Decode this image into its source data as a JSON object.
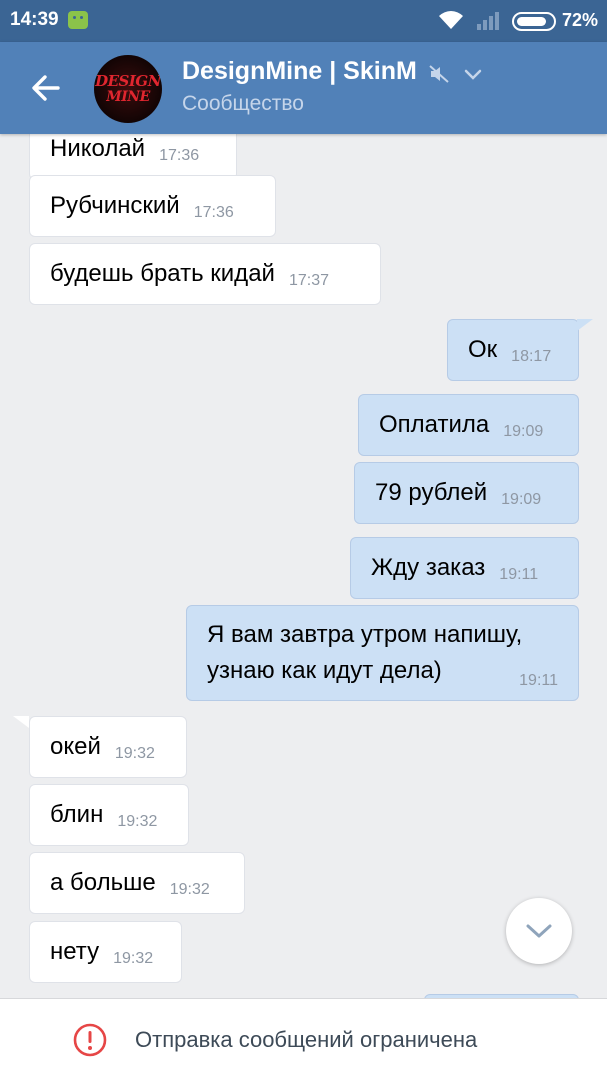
{
  "status_bar": {
    "time": "14:39",
    "battery": "72%",
    "icons": [
      "android-icon",
      "wifi-icon",
      "signal-icon",
      "battery-icon"
    ]
  },
  "header": {
    "title": "DesignMine | SkinM",
    "subtitle": "Сообщество",
    "avatar_text_line1": "DESIGN",
    "avatar_text_line2": "MINE",
    "icons": [
      "back-arrow-icon",
      "mute-icon",
      "chevron-down-icon"
    ]
  },
  "messages": [
    {
      "dir": "in",
      "text": "Николай",
      "time": "17:36"
    },
    {
      "dir": "in",
      "text": "Рубчинский",
      "time": "17:36"
    },
    {
      "dir": "in",
      "text": "будешь брать кидай",
      "time": "17:37"
    },
    {
      "dir": "out",
      "text": "Ок",
      "time": "18:17"
    },
    {
      "dir": "out",
      "text": "Оплатила",
      "time": "19:09"
    },
    {
      "dir": "out",
      "text": "79 рублей",
      "time": "19:09"
    },
    {
      "dir": "out",
      "text": "Жду заказ",
      "time": "19:11"
    },
    {
      "dir": "out",
      "lines": [
        "Я вам завтра утром напишу,",
        "узнаю как идут дела)"
      ],
      "time": "19:11"
    },
    {
      "dir": "in",
      "text": "окей",
      "time": "19:32"
    },
    {
      "dir": "in",
      "text": "блин",
      "time": "19:32"
    },
    {
      "dir": "in",
      "text": "а больше",
      "time": "19:32"
    },
    {
      "dir": "in",
      "text": "нету",
      "time": "19:32"
    }
  ],
  "bottom_bar": {
    "text": "Отправка сообщений ограничена",
    "icon": "warning-icon"
  },
  "colors": {
    "status_bar": "#3b6594",
    "header": "#5181b8",
    "background": "#edeef0",
    "incoming_bubble": "#ffffff",
    "outgoing_bubble": "#cce0f5",
    "warning": "#e64646"
  }
}
